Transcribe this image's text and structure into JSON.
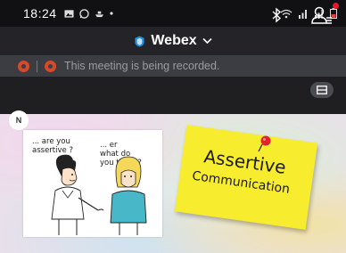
{
  "status_bar": {
    "time": "18:24",
    "icons_left": [
      "gallery-icon",
      "whatsapp-icon",
      "boat-icon",
      "dot-icon"
    ],
    "icons_right": [
      "wifi-icon",
      "signal-icon",
      "signal-icon",
      "battery-icon"
    ]
  },
  "header": {
    "app_name": "Webex",
    "bluetooth_icon": "bluetooth-icon",
    "participants_icon": "participants-icon"
  },
  "recording": {
    "message": "This meeting is being recorded."
  },
  "shared_content": {
    "presenter_initial": "N",
    "cartoon": {
      "left_speech": "... are you\nassertive ?",
      "right_speech": "... er\nwhat do\nyou think ?"
    },
    "sticky_note": {
      "title": "Assertive",
      "subtitle": "Communication"
    }
  },
  "colors": {
    "accent_red": "#e21a2a",
    "recording_orange": "#d64a2a",
    "sticky_yellow": "#f8ec2e"
  }
}
